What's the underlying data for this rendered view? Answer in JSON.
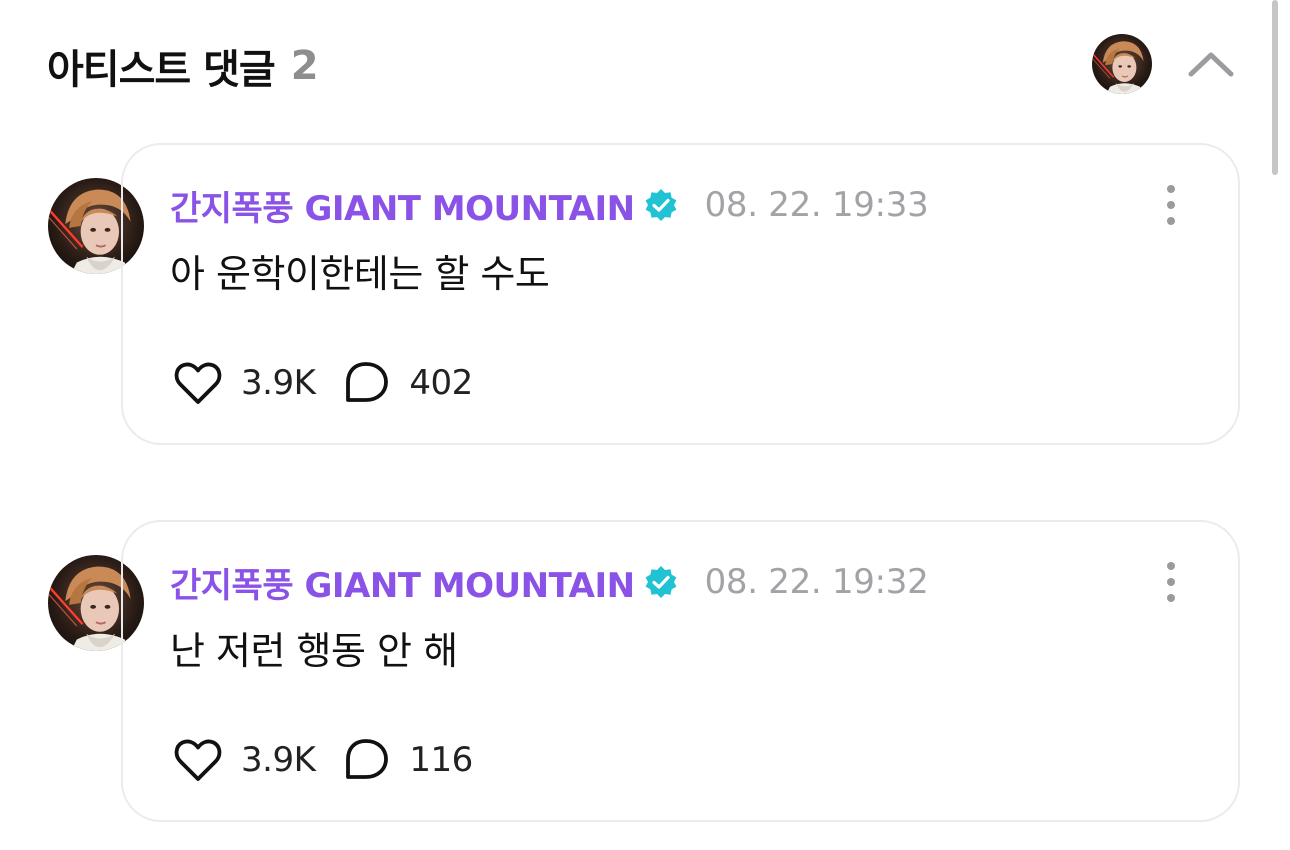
{
  "section": {
    "title": "아티스트 댓글",
    "count": "2",
    "collapse_icon": "chevron-up-icon"
  },
  "comments": [
    {
      "author": "간지폭풍 GIANT MOUNTAIN",
      "verified_icon": "verified-badge-icon",
      "timestamp": "08. 22. 19:33",
      "text": "아 운학이한테는 할 수도",
      "likes": "3.9K",
      "replies": "402"
    },
    {
      "author": "간지폭풍 GIANT MOUNTAIN",
      "verified_icon": "verified-badge-icon",
      "timestamp": "08. 22. 19:32",
      "text": "난 저런 행동 안 해",
      "likes": "3.9K",
      "replies": "116"
    }
  ],
  "colors": {
    "author": "#8a52e6",
    "verified": "#20c2d4",
    "timestamp": "#a2a2a7",
    "count": "#8e8e8e",
    "card_border": "#ebebee"
  }
}
